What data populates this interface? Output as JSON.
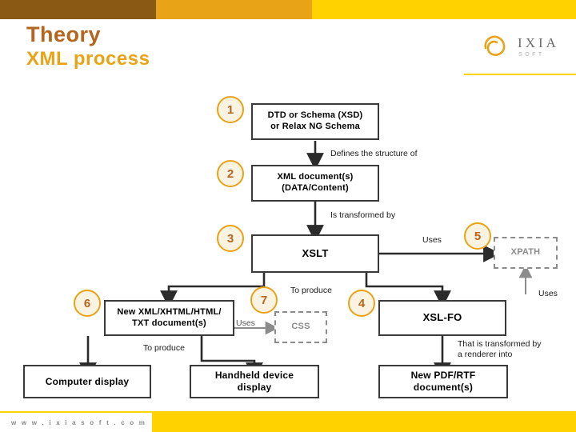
{
  "header": {
    "title": "Theory",
    "subtitle": "XML process",
    "logo": {
      "name": "IXIA",
      "tagline": "SOFT",
      "icon": "ixia-swoosh-icon"
    }
  },
  "footer": {
    "url": "w w w . i x i a s o f t . c o m"
  },
  "diagram": {
    "steps": [
      {
        "number": "1",
        "label": "DTD or Schema (XSD)\nor  Relax NG Schema"
      },
      {
        "number": "2",
        "label": "XML document(s)\n(DATA/Content)"
      },
      {
        "number": "3",
        "label": "XSLT"
      },
      {
        "number": "4",
        "label": "XSL-FO"
      },
      {
        "number": "5",
        "label": "XPATH"
      },
      {
        "number": "6",
        "label": "New XML/XHTML/HTML/\nTXT document(s)"
      },
      {
        "number": "7",
        "label": "CSS"
      }
    ],
    "boxes": {
      "schema_line1": "DTD or Schema (XSD)",
      "schema_line2": "or  Relax NG Schema",
      "xml_line1": "XML document(s)",
      "xml_line2": "(DATA/Content)",
      "xslt": "XSLT",
      "xslfo": "XSL-FO",
      "xpath": "XPATH",
      "css": "CSS",
      "newdoc_line1": "New XML/XHTML/HTML/",
      "newdoc_line2": "TXT document(s)",
      "computer_display": "Computer display",
      "handheld_line1": "Handheld device",
      "handheld_line2": "display",
      "pdf_line1": "New PDF/RTF",
      "pdf_line2": "document(s)"
    },
    "connector_labels": {
      "defines": "Defines the structure of",
      "transformed_by": "Is transformed by",
      "uses_xpath": "Uses",
      "uses_xslfo": "Uses",
      "uses_css": "Uses",
      "to_produce_top": "To produce",
      "to_produce_bottom": "To produce",
      "renderer_line1": "That is transformed by",
      "renderer_line2": "a renderer into"
    },
    "numbers": [
      "1",
      "2",
      "3",
      "4",
      "5",
      "6",
      "7"
    ]
  },
  "colors": {
    "brand_brown": "#8a5a14",
    "brand_orange": "#e8a317",
    "brand_yellow": "#ffd200",
    "title": "#b5651d",
    "box_border": "#3a3a3a",
    "dashed_border": "#8c8c8c"
  }
}
